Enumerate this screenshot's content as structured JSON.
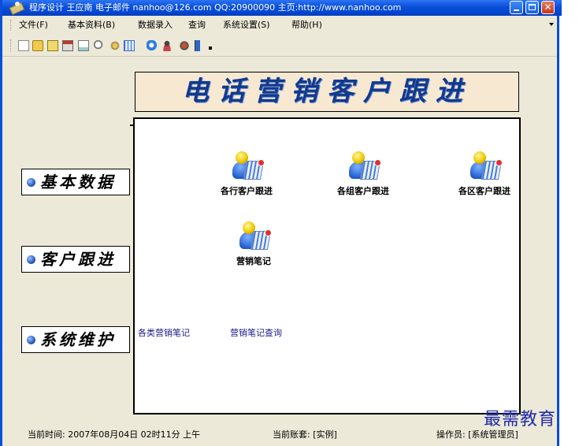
{
  "window": {
    "title": "程序设计 王应南 电子邮件 nanhoo@126.com  QQ:20900090 主页:http://www.nanhoo.com"
  },
  "menu": [
    {
      "label": "文件(F)"
    },
    {
      "label": "基本资料(B)"
    },
    {
      "label": "数据录入"
    },
    {
      "label": "查询"
    },
    {
      "label": "系统设置(S)"
    },
    {
      "label": "帮助(H)"
    }
  ],
  "toolbar": {
    "icons": [
      "new-icon",
      "open-icon",
      "save-icon",
      "print-icon",
      "print-preview-icon",
      "find-icon",
      "tools-icon",
      "grid-icon",
      "ie-icon",
      "user-icon",
      "settings-icon",
      "exit-icon"
    ]
  },
  "banner": {
    "title": "电话营销客户跟进"
  },
  "nav": [
    {
      "label": "基本数据"
    },
    {
      "label": "客户跟进"
    },
    {
      "label": "系统维护"
    }
  ],
  "customer_items": [
    {
      "label": "各行客户跟进"
    },
    {
      "label": "各组客户跟进"
    },
    {
      "label": "各区客户跟进"
    },
    {
      "label": "营销笔记"
    }
  ],
  "links": [
    {
      "label": "各类营销笔记"
    },
    {
      "label": "营销笔记查询"
    }
  ],
  "status": {
    "time": "当前时间: 2007年08月04日 02时11分 上午",
    "account": "当前账套: [实例]",
    "operator": "操作员: [系统管理员]"
  },
  "watermark": "最需教育"
}
